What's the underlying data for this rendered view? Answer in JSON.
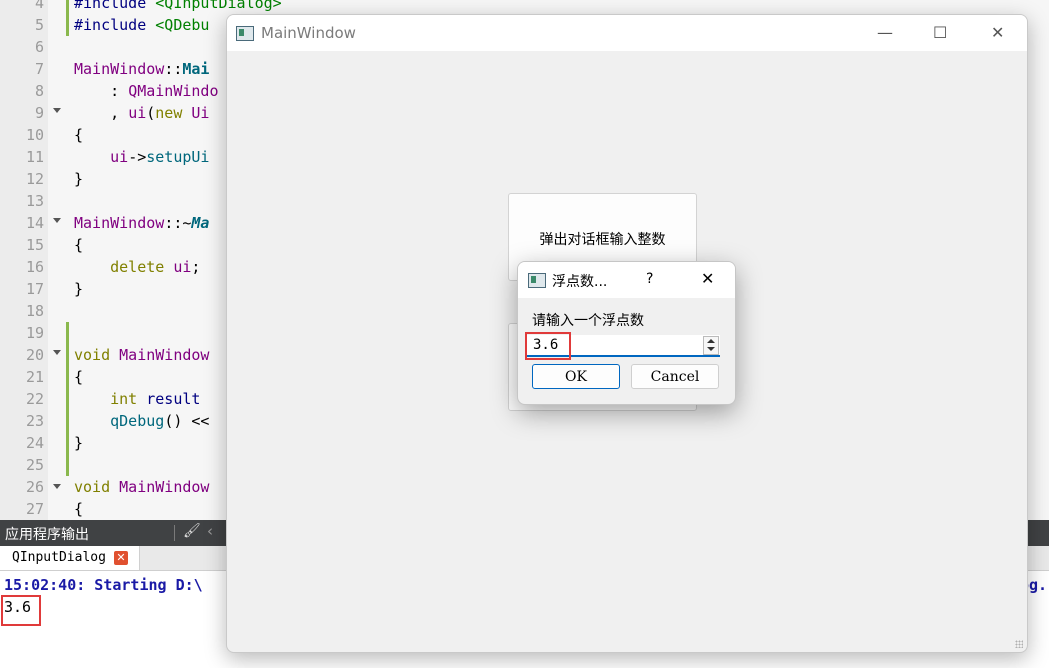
{
  "editor": {
    "line_numbers": [
      "4",
      "5",
      "6",
      "7",
      "8",
      "9",
      "10",
      "11",
      "12",
      "13",
      "14",
      "15",
      "16",
      "17",
      "18",
      "19",
      "20",
      "21",
      "22",
      "23",
      "24",
      "25",
      "26",
      "27"
    ],
    "code": {
      "l4_kw": "#include",
      "l4_str": "<QInputDialog>",
      "l5_kw": "#include",
      "l5_str": "<QDebu",
      "l7_cls": "MainWindow",
      "l7_sep": "::",
      "l7_fn": "Mai",
      "l8_colon": ": ",
      "l8_cls": "QMainWindo",
      "l9_comma": ", ",
      "l9_mem": "ui",
      "l9_paren": "(",
      "l9_new": "new",
      "l9_cls": " Ui",
      "l10": "{",
      "l11_mem": "ui",
      "l11_arrow": "->",
      "l11_fn": "setupUi",
      "l12": "}",
      "l14_cls": "MainWindow",
      "l14_sep": "::~",
      "l14_fn": "Ma",
      "l15": "{",
      "l16_kw": "delete",
      "l16_mem": " ui",
      "l16_semi": ";",
      "l17": "}",
      "l20_kw": "void",
      "l20_cls": " MainWindow",
      "l21": "{",
      "l22_kw": "int",
      "l22_var": " result",
      "l23_fn": "qDebug",
      "l23_rest": "() <<",
      "l24": "}",
      "l26_kw": "void",
      "l26_cls": " MainWindow",
      "l27": "{"
    }
  },
  "output": {
    "title": "应用程序输出",
    "tab_label": "QInputDialog",
    "tab_close": "✕",
    "line1": "15:02:40: Starting D:\\",
    "line1_tail": "og.",
    "line2": "3.6"
  },
  "main_window": {
    "title": "MainWindow",
    "minimize": "—",
    "maximize": "☐",
    "close": "✕",
    "button1_label": "弹出对话框输入整数"
  },
  "dialog": {
    "title": "浮点数...",
    "help": "?",
    "close": "✕",
    "prompt": "请输入一个浮点数",
    "value": "3.6",
    "ok_label": "OK",
    "cancel_label": "Cancel"
  },
  "colors": {
    "highlight_box": "#e03a3a",
    "focus_accent": "#0067c0"
  }
}
